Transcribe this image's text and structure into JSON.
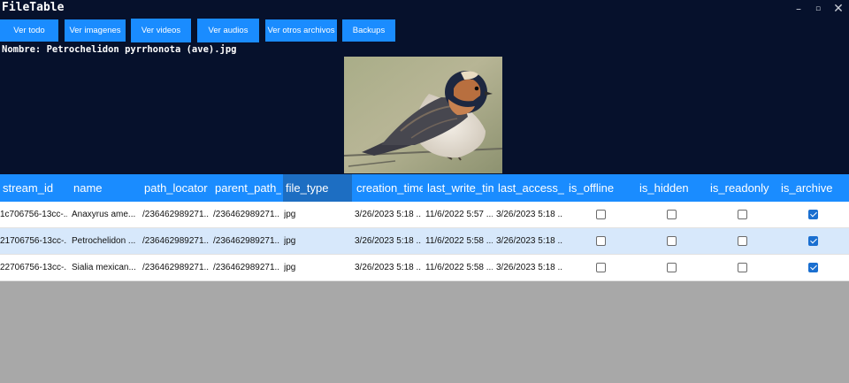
{
  "window": {
    "title": "FileTable",
    "controls": {
      "minimize": "–",
      "maximize": "▫",
      "close": "✕"
    }
  },
  "nav_buttons": [
    "Ver todo",
    "Ver imagenes",
    "Ver videos",
    "Ver audios",
    "Ver otros archivos",
    "Backups"
  ],
  "preview": {
    "caption": "Nombre: Petrochelidon pyrrhonota (ave).jpg",
    "image_subject": "bird (swallow) photo"
  },
  "table": {
    "columns": [
      "stream_id",
      "name",
      "path_locator",
      "parent_path_l",
      "file_type",
      "creation_time",
      "last_write_tim",
      "last_access_ti",
      "is_offline",
      "is_hidden",
      "is_readonly",
      "is_archive"
    ],
    "selected_column": "file_type",
    "rows": [
      {
        "stream_id": "1c706756-13cc-...",
        "name": "Anaxyrus ame...",
        "path_locator": "/236462989271...",
        "parent_path": "/236462989271...",
        "file_type": "jpg",
        "creation_time": "3/26/2023 5:18 ...",
        "last_write_time": "11/6/2022 5:57 ...",
        "last_access_time": "3/26/2023 5:18 ...",
        "is_offline": false,
        "is_hidden": false,
        "is_readonly": false,
        "is_archive": true
      },
      {
        "stream_id": "21706756-13cc-...",
        "name": "Petrochelidon ...",
        "path_locator": "/236462989271...",
        "parent_path": "/236462989271...",
        "file_type": "jpg",
        "creation_time": "3/26/2023 5:18 ...",
        "last_write_time": "11/6/2022 5:58 ...",
        "last_access_time": "3/26/2023 5:18 ...",
        "is_offline": false,
        "is_hidden": false,
        "is_readonly": false,
        "is_archive": true
      },
      {
        "stream_id": "22706756-13cc-...",
        "name": "Sialia mexican...",
        "path_locator": "/236462989271...",
        "parent_path": "/236462989271...",
        "file_type": "jpg",
        "creation_time": "3/26/2023 5:18 ...",
        "last_write_time": "11/6/2022 5:58 ...",
        "last_access_time": "3/26/2023 5:18 ...",
        "is_offline": false,
        "is_hidden": false,
        "is_readonly": false,
        "is_archive": true
      }
    ]
  },
  "colors": {
    "top_background": "#06112c",
    "accent": "#1a8cff",
    "selected_header": "#1d6ec2",
    "alt_row": "#d7e8fb",
    "empty_area": "#a8a8a8"
  }
}
